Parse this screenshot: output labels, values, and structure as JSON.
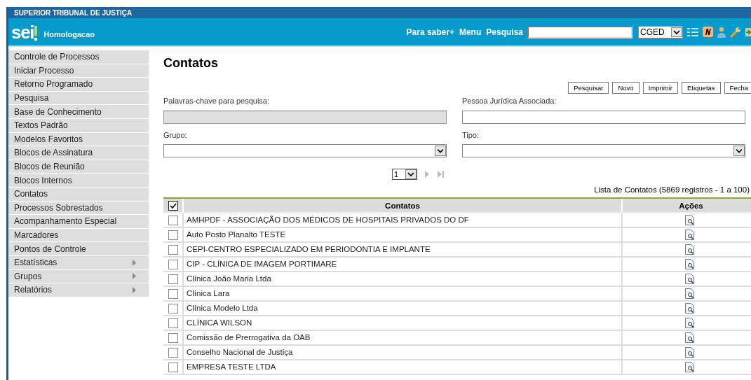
{
  "org": "SUPERIOR TRIBUNAL DE JUSTIÇA",
  "logo": "sei",
  "environment": "Homologacao",
  "top_links": [
    "Para saber+",
    "Menu",
    "Pesquisa"
  ],
  "unit_select": {
    "value": "CGED"
  },
  "sidebar": {
    "items": [
      {
        "label": "Controle de Processos",
        "submenu": false
      },
      {
        "label": "Iniciar Processo",
        "submenu": false
      },
      {
        "label": "Retorno Programado",
        "submenu": false
      },
      {
        "label": "Pesquisa",
        "submenu": false
      },
      {
        "label": "Base de Conhecimento",
        "submenu": false
      },
      {
        "label": "Textos Padrão",
        "submenu": false
      },
      {
        "label": "Modelos Favoritos",
        "submenu": false
      },
      {
        "label": "Blocos de Assinatura",
        "submenu": false
      },
      {
        "label": "Blocos de Reunião",
        "submenu": false
      },
      {
        "label": "Blocos Internos",
        "submenu": false
      },
      {
        "label": "Contatos",
        "submenu": false
      },
      {
        "label": "Processos Sobrestados",
        "submenu": false
      },
      {
        "label": "Acompanhamento Especial",
        "submenu": false
      },
      {
        "label": "Marcadores",
        "submenu": false
      },
      {
        "label": "Pontos de Controle",
        "submenu": false
      },
      {
        "label": "Estatísticas",
        "submenu": true
      },
      {
        "label": "Grupos",
        "submenu": true
      },
      {
        "label": "Relatórios",
        "submenu": true
      }
    ]
  },
  "page_title": "Contatos",
  "buttons": [
    "Pesquisar",
    "Novo",
    "Imprimir",
    "Etiquetas",
    "Fecha"
  ],
  "filters": [
    {
      "label": "Palavras-chave para pesquisa:",
      "kind": "text",
      "disabled": true
    },
    {
      "label": "Pessoa Jurídica Associada:",
      "kind": "text",
      "disabled": false
    },
    {
      "label": "Grupo:",
      "kind": "select",
      "disabled": false
    },
    {
      "label": "Tipo:",
      "kind": "select",
      "disabled": false
    }
  ],
  "pagination": {
    "page": "1"
  },
  "table": {
    "caption": "Lista de Contatos (5869 registros - 1 a 100)",
    "all_checked": true,
    "columns": [
      "Contatos",
      "Ações"
    ],
    "rows": [
      {
        "name": "AMHPDF - ASSOCIAÇÃO DOS MÉDICOS DE HOSPITAIS PRIVADOS DO DF",
        "checked": false
      },
      {
        "name": "Auto Posto Planalto TESTE",
        "checked": false
      },
      {
        "name": "CEPI-CENTRO ESPECIALIZADO EM PERIODONTIA E IMPLANTE",
        "checked": false
      },
      {
        "name": "CIP - CLÍNICA DE IMAGEM PORTIMARE",
        "checked": false
      },
      {
        "name": "Clínica João Maria Ltda",
        "checked": false
      },
      {
        "name": "Clínica Lara",
        "checked": false
      },
      {
        "name": "Clínica Modelo Ltda",
        "checked": false
      },
      {
        "name": "CLÍNICA WILSON",
        "checked": false
      },
      {
        "name": "Comissão de Prerrogativa da OAB",
        "checked": false
      },
      {
        "name": "Conselho Nacional de Justiça",
        "checked": false
      },
      {
        "name": "EMPRESA TESTE LTDA",
        "checked": false
      }
    ]
  }
}
